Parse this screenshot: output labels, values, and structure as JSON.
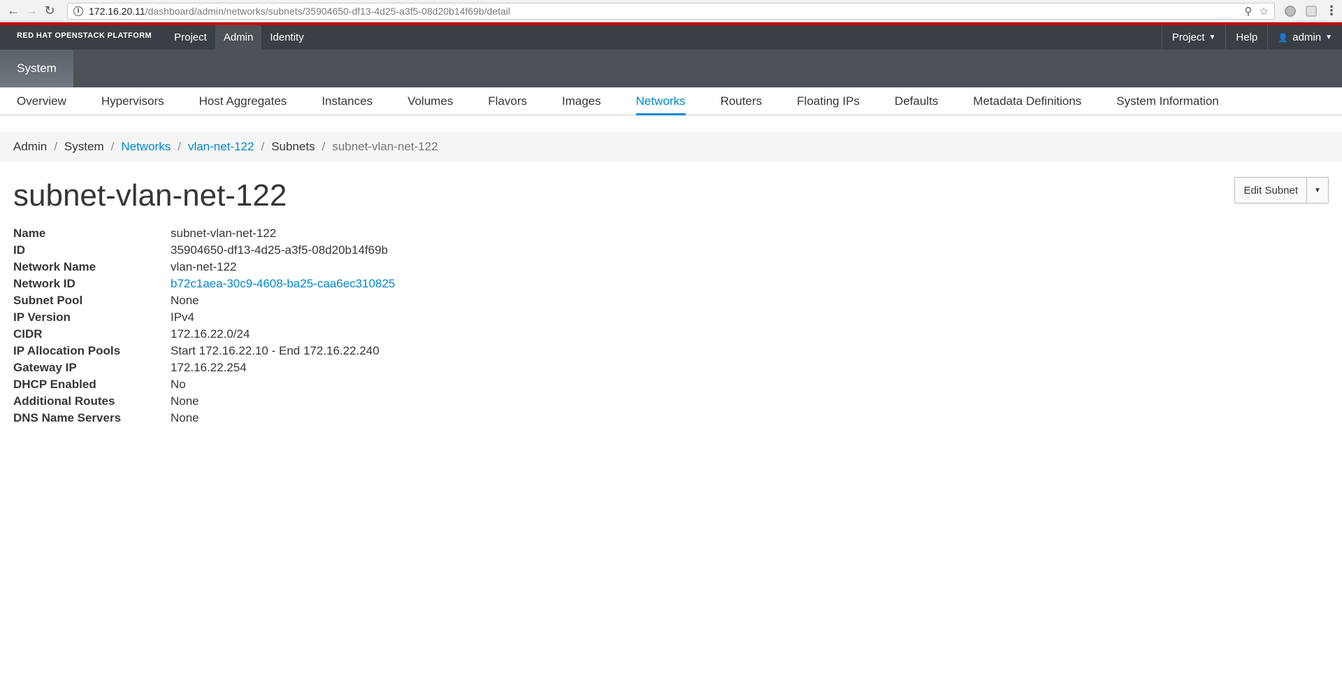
{
  "browser": {
    "url_host": "172.16.20.11",
    "url_path": "/dashboard/admin/networks/subnets/35904650-df13-4d25-a3f5-08d20b14f69b/detail"
  },
  "masthead": {
    "brand": "RED HAT OPENSTACK PLATFORM",
    "nav": [
      "Project",
      "Admin",
      "Identity"
    ],
    "active_nav": "Admin",
    "right": {
      "project_label": "Project",
      "help_label": "Help",
      "user_label": "admin"
    }
  },
  "system_tab": "System",
  "sub_nav": {
    "tabs": [
      "Overview",
      "Hypervisors",
      "Host Aggregates",
      "Instances",
      "Volumes",
      "Flavors",
      "Images",
      "Networks",
      "Routers",
      "Floating IPs",
      "Defaults",
      "Metadata Definitions",
      "System Information"
    ],
    "active": "Networks"
  },
  "breadcrumb": [
    "Admin",
    "System",
    "Networks",
    "vlan-net-122",
    "Subnets",
    "subnet-vlan-net-122"
  ],
  "page_title": "subnet-vlan-net-122",
  "actions": {
    "edit_label": "Edit Subnet"
  },
  "details": [
    {
      "label": "Name",
      "value": "subnet-vlan-net-122"
    },
    {
      "label": "ID",
      "value": "35904650-df13-4d25-a3f5-08d20b14f69b"
    },
    {
      "label": "Network Name",
      "value": "vlan-net-122"
    },
    {
      "label": "Network ID",
      "value": "b72c1aea-30c9-4608-ba25-caa6ec310825"
    },
    {
      "label": "Subnet Pool",
      "value": "None"
    },
    {
      "label": "IP Version",
      "value": "IPv4"
    },
    {
      "label": "CIDR",
      "value": "172.16.22.0/24"
    },
    {
      "label": "IP Allocation Pools",
      "value": "Start 172.16.22.10 - End 172.16.22.240"
    },
    {
      "label": "Gateway IP",
      "value": "172.16.22.254"
    },
    {
      "label": "DHCP Enabled",
      "value": "No"
    },
    {
      "label": "Additional Routes",
      "value": "None"
    },
    {
      "label": "DNS Name Servers",
      "value": "None"
    }
  ],
  "colors": {
    "accent": "#0088ce",
    "masthead": "#393f44",
    "masthead_stripe": "#cc0000"
  }
}
